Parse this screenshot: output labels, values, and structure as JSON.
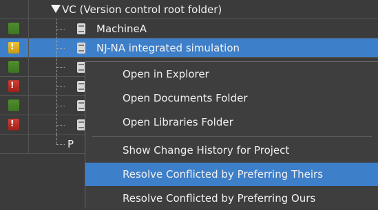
{
  "tree": {
    "root_label": "VC (Version control root folder)",
    "rows": [
      {
        "status": "ok",
        "label": "MachineA"
      },
      {
        "status": "warn",
        "label": "NJ-NA integrated simulation"
      },
      {
        "status": "ok",
        "label": ""
      },
      {
        "status": "err",
        "label": ""
      },
      {
        "status": "ok",
        "label": ""
      },
      {
        "status": "err",
        "label": ""
      },
      {
        "status": "none",
        "label": "P"
      }
    ]
  },
  "context_menu": {
    "items": [
      {
        "label": "Open in Explorer",
        "highlight": false
      },
      {
        "label": "Open Documents Folder",
        "highlight": false
      },
      {
        "label": "Open Libraries Folder",
        "highlight": false
      },
      {
        "label": "Show Change History for Project",
        "highlight": false
      },
      {
        "label": "Resolve Conflicted by Preferring Theirs",
        "highlight": true
      },
      {
        "label": "Resolve Conflicted by Preferring Ours",
        "highlight": false
      }
    ]
  },
  "colors": {
    "selection": "#3e7fc9",
    "background": "#3b3b3b",
    "text": "#f2f2f2"
  }
}
